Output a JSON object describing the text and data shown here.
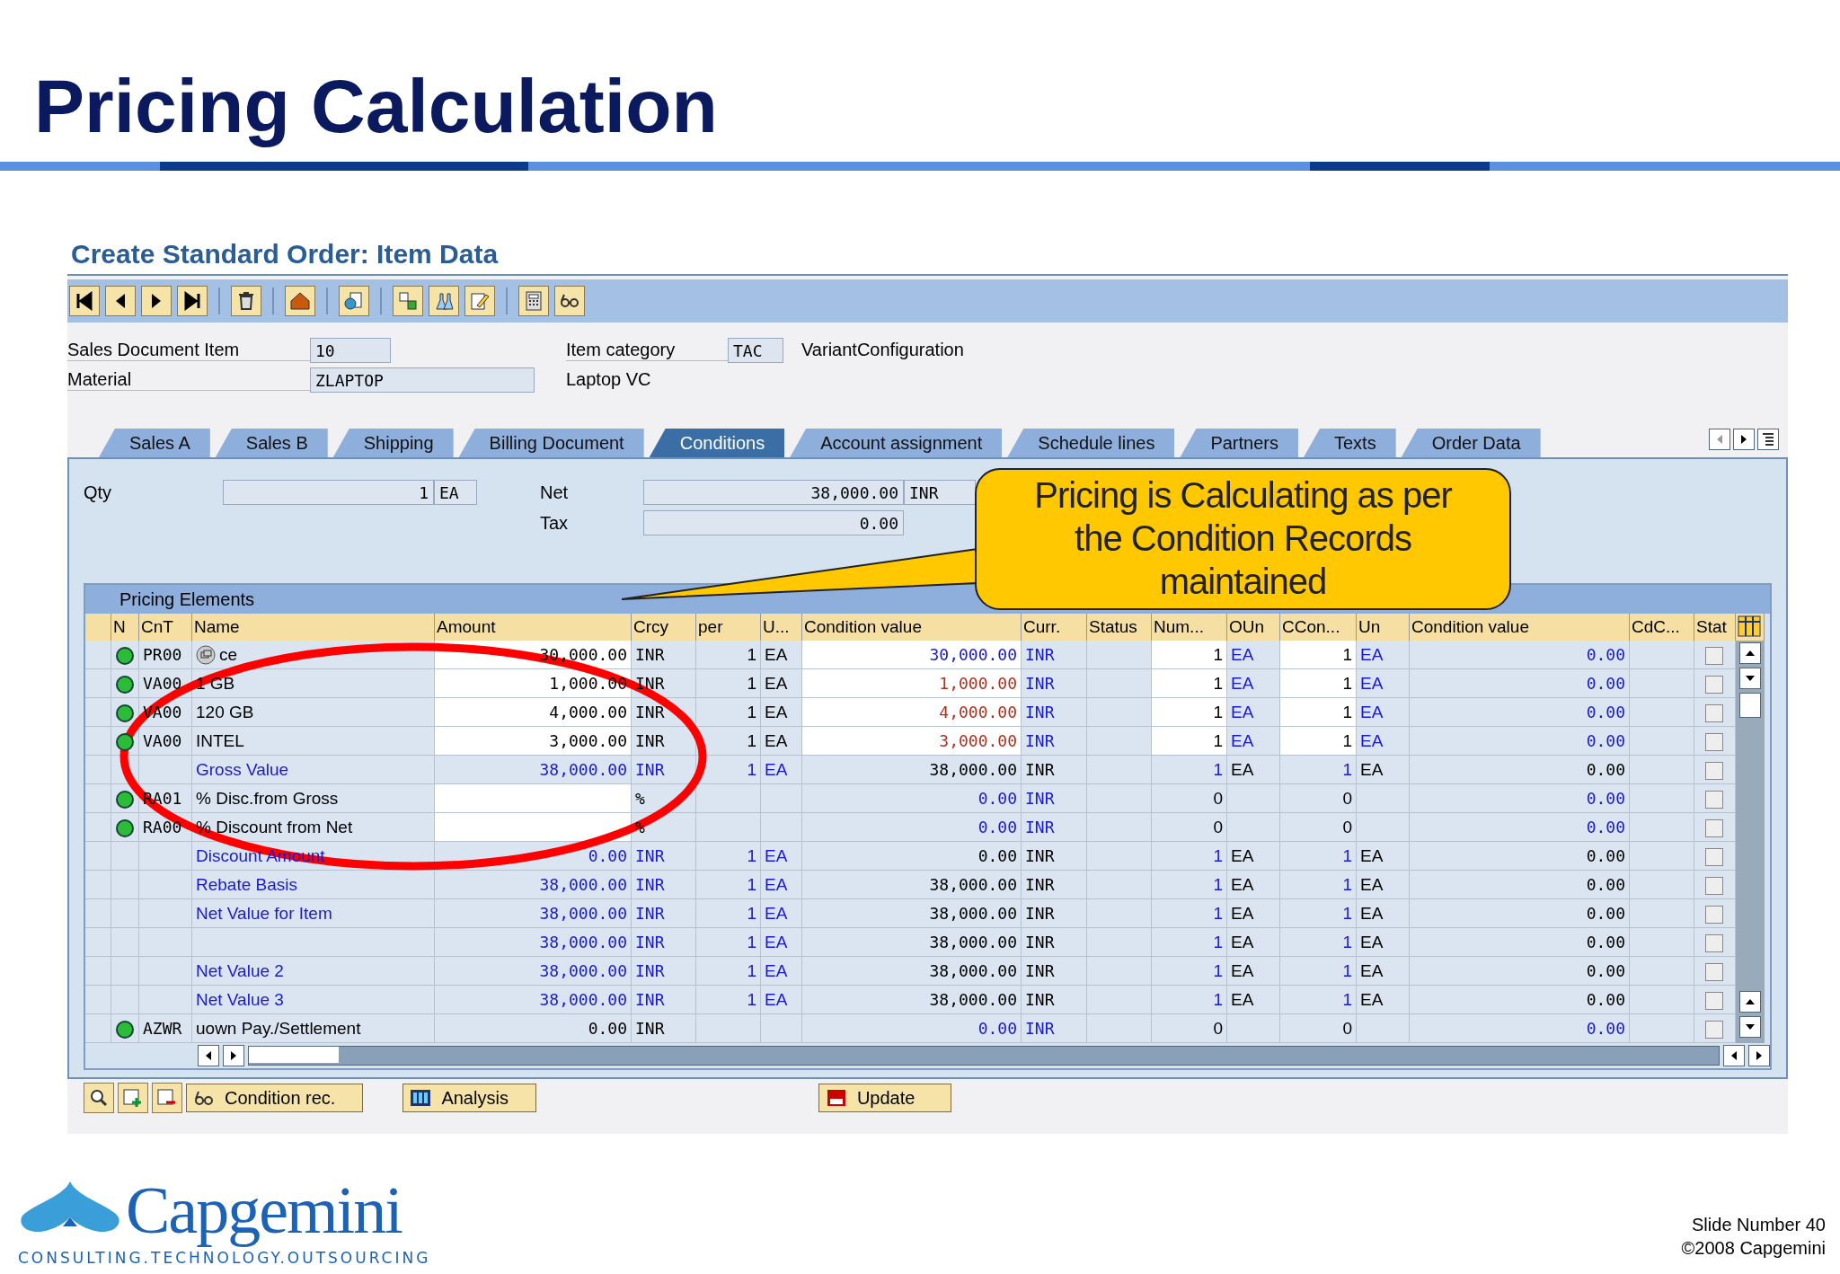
{
  "slide_title": "Pricing Calculation",
  "window": {
    "title": "Create Standard Order: Item Data"
  },
  "header_fields": [
    {
      "label": "Sales Document Item",
      "value": "10",
      "text": "Item category",
      "value2": "TAC",
      "note": "VariantConfiguration"
    },
    {
      "label": "Material",
      "value": "ZLAPTOP",
      "text": "Laptop VC"
    }
  ],
  "tabs": [
    {
      "label": "Sales A",
      "selected": false
    },
    {
      "label": "Sales B",
      "selected": false
    },
    {
      "label": "Shipping",
      "selected": false
    },
    {
      "label": "Billing Document",
      "selected": false
    },
    {
      "label": "Conditions",
      "selected": true
    },
    {
      "label": "Account assignment",
      "selected": false
    },
    {
      "label": "Schedule lines",
      "selected": false
    },
    {
      "label": "Partners",
      "selected": false
    },
    {
      "label": "Texts",
      "selected": false
    },
    {
      "label": "Order Data",
      "selected": false
    }
  ],
  "totals": {
    "qty_label": "Qty",
    "qty": "1",
    "qty_unit": "EA",
    "net_label": "Net",
    "net": "38,000.00",
    "net_currency": "INR",
    "tax_label": "Tax",
    "tax": "0.00"
  },
  "pricing": {
    "title": "Pricing Elements",
    "columns": [
      "N",
      "CnT",
      "Name",
      "Amount",
      "Crcy",
      "per",
      "U...",
      "Condition value",
      "Curr.",
      "Status",
      "Num...",
      "OUn",
      "CCon...",
      "Un",
      "Condition value",
      "CdC...",
      "Stat"
    ],
    "rows": [
      {
        "kind": "price",
        "active": true,
        "type": "PR00",
        "name": "ce",
        "amount": "30,000.00",
        "crcy": "INR",
        "per": "1",
        "uom": "EA",
        "value": "30,000.00",
        "curr": "INR",
        "num": "1",
        "oun": "EA",
        "ccon": "1",
        "un": "EA",
        "value2": "0.00"
      },
      {
        "kind": "variant",
        "active": true,
        "type": "VA00",
        "name": "1 GB",
        "amount": "1,000.00",
        "crcy": "INR",
        "per": "1",
        "uom": "EA",
        "value": "1,000.00",
        "curr": "INR",
        "num": "1",
        "oun": "EA",
        "ccon": "1",
        "un": "EA",
        "value2": "0.00"
      },
      {
        "kind": "variant",
        "active": true,
        "type": "VA00",
        "name": "120 GB",
        "amount": "4,000.00",
        "crcy": "INR",
        "per": "1",
        "uom": "EA",
        "value": "4,000.00",
        "curr": "INR",
        "num": "1",
        "oun": "EA",
        "ccon": "1",
        "un": "EA",
        "value2": "0.00"
      },
      {
        "kind": "variant",
        "active": true,
        "type": "VA00",
        "name": "INTEL",
        "amount": "3,000.00",
        "crcy": "INR",
        "per": "1",
        "uom": "EA",
        "value": "3,000.00",
        "curr": "INR",
        "num": "1",
        "oun": "EA",
        "ccon": "1",
        "un": "EA",
        "value2": "0.00"
      },
      {
        "kind": "subtotal",
        "active": false,
        "name": "Gross Value",
        "amount": "38,000.00",
        "crcy": "INR",
        "per": "1",
        "uom": "EA",
        "value": "38,000.00",
        "curr": "INR",
        "num": "1",
        "oun": "EA",
        "ccon": "1",
        "un": "EA",
        "value2": "0.00"
      },
      {
        "kind": "discount",
        "active": true,
        "type": "RA01",
        "name": "% Disc.from Gross",
        "crcy": "%",
        "value": "0.00",
        "curr": "INR",
        "num": "0",
        "ccon": "0",
        "value2": "0.00"
      },
      {
        "kind": "discount",
        "active": true,
        "type": "RA00",
        "name": "% Discount from Net",
        "crcy": "%",
        "value": "0.00",
        "curr": "INR",
        "num": "0",
        "ccon": "0",
        "value2": "0.00"
      },
      {
        "kind": "subtotal",
        "active": false,
        "name": "Discount Amount",
        "amount": "0.00",
        "crcy": "INR",
        "per": "1",
        "uom": "EA",
        "value": "0.00",
        "curr": "INR",
        "num": "1",
        "oun": "EA",
        "ccon": "1",
        "un": "EA",
        "value2": "0.00"
      },
      {
        "kind": "subtotal",
        "active": false,
        "name": "Rebate Basis",
        "amount": "38,000.00",
        "crcy": "INR",
        "per": "1",
        "uom": "EA",
        "value": "38,000.00",
        "curr": "INR",
        "num": "1",
        "oun": "EA",
        "ccon": "1",
        "un": "EA",
        "value2": "0.00"
      },
      {
        "kind": "subtotal",
        "active": false,
        "name": "Net Value for Item",
        "amount": "38,000.00",
        "crcy": "INR",
        "per": "1",
        "uom": "EA",
        "value": "38,000.00",
        "curr": "INR",
        "num": "1",
        "oun": "EA",
        "ccon": "1",
        "un": "EA",
        "value2": "0.00"
      },
      {
        "kind": "subtotal",
        "active": false,
        "amount": "38,000.00",
        "crcy": "INR",
        "per": "1",
        "uom": "EA",
        "value": "38,000.00",
        "curr": "INR",
        "num": "1",
        "oun": "EA",
        "ccon": "1",
        "un": "EA",
        "value2": "0.00"
      },
      {
        "kind": "subtotal",
        "active": false,
        "name": "Net Value 2",
        "amount": "38,000.00",
        "crcy": "INR",
        "per": "1",
        "uom": "EA",
        "value": "38,000.00",
        "curr": "INR",
        "num": "1",
        "oun": "EA",
        "ccon": "1",
        "un": "EA",
        "value2": "0.00"
      },
      {
        "kind": "subtotal",
        "active": false,
        "name": "Net Value 3",
        "amount": "38,000.00",
        "crcy": "INR",
        "per": "1",
        "uom": "EA",
        "value": "38,000.00",
        "curr": "INR",
        "num": "1",
        "oun": "EA",
        "ccon": "1",
        "un": "EA",
        "value2": "0.00"
      },
      {
        "kind": "settlement",
        "active": true,
        "type": "AZWR",
        "name": "uown Pay./Settlement",
        "amount": "0.00",
        "crcy": "INR",
        "value": "0.00",
        "curr": "INR",
        "num": "0",
        "ccon": "0",
        "value2": "0.00"
      }
    ]
  },
  "status_checked": [
    false,
    false,
    false,
    false,
    false,
    false,
    false,
    false,
    false,
    false,
    false,
    false,
    false,
    false
  ],
  "buttons": [
    {
      "label": "Condition rec."
    },
    {
      "label": "Analysis"
    },
    {
      "label": "Update"
    }
  ],
  "callout": "Pricing is Calculating as per the Condition Records maintained",
  "footer": {
    "logo": "Capgemini",
    "tagline": "CONSULTING.TECHNOLOGY.OUTSOURCING",
    "slide_number": "Slide Number 40",
    "copyright": "©2008 Capgemini"
  }
}
